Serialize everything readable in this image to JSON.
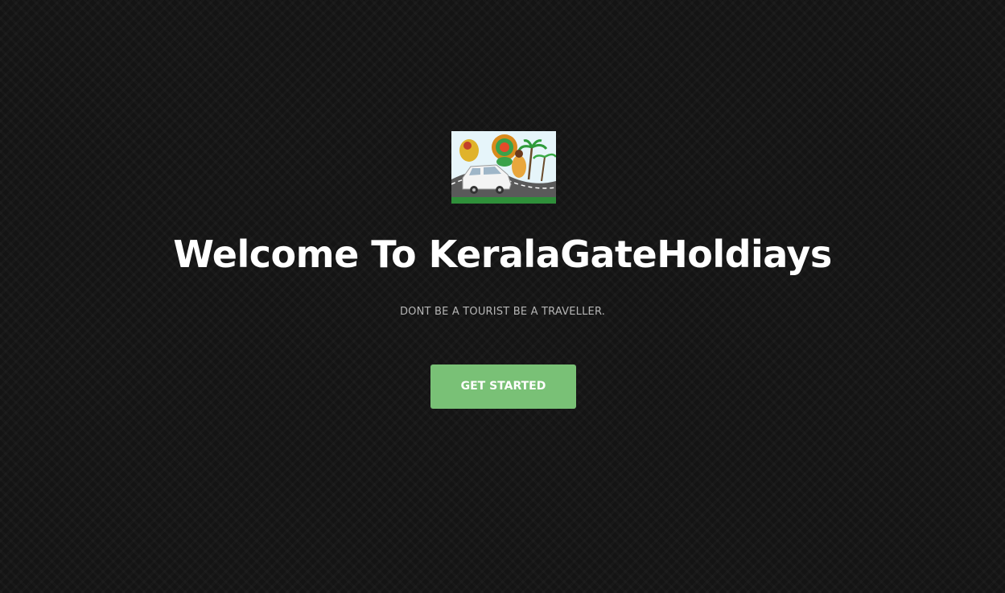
{
  "hero": {
    "title": "Welcome To KeralaGateHoldiays",
    "tagline": "DONT BE A TOURIST BE A TRAVELLER.",
    "cta_label": "GET STARTED"
  },
  "logo": {
    "alt": "KeralaGateHoldiays logo"
  },
  "colors": {
    "background": "#141414",
    "cta": "#79c176",
    "title": "#ffffff",
    "tagline": "#b5b5b5"
  }
}
